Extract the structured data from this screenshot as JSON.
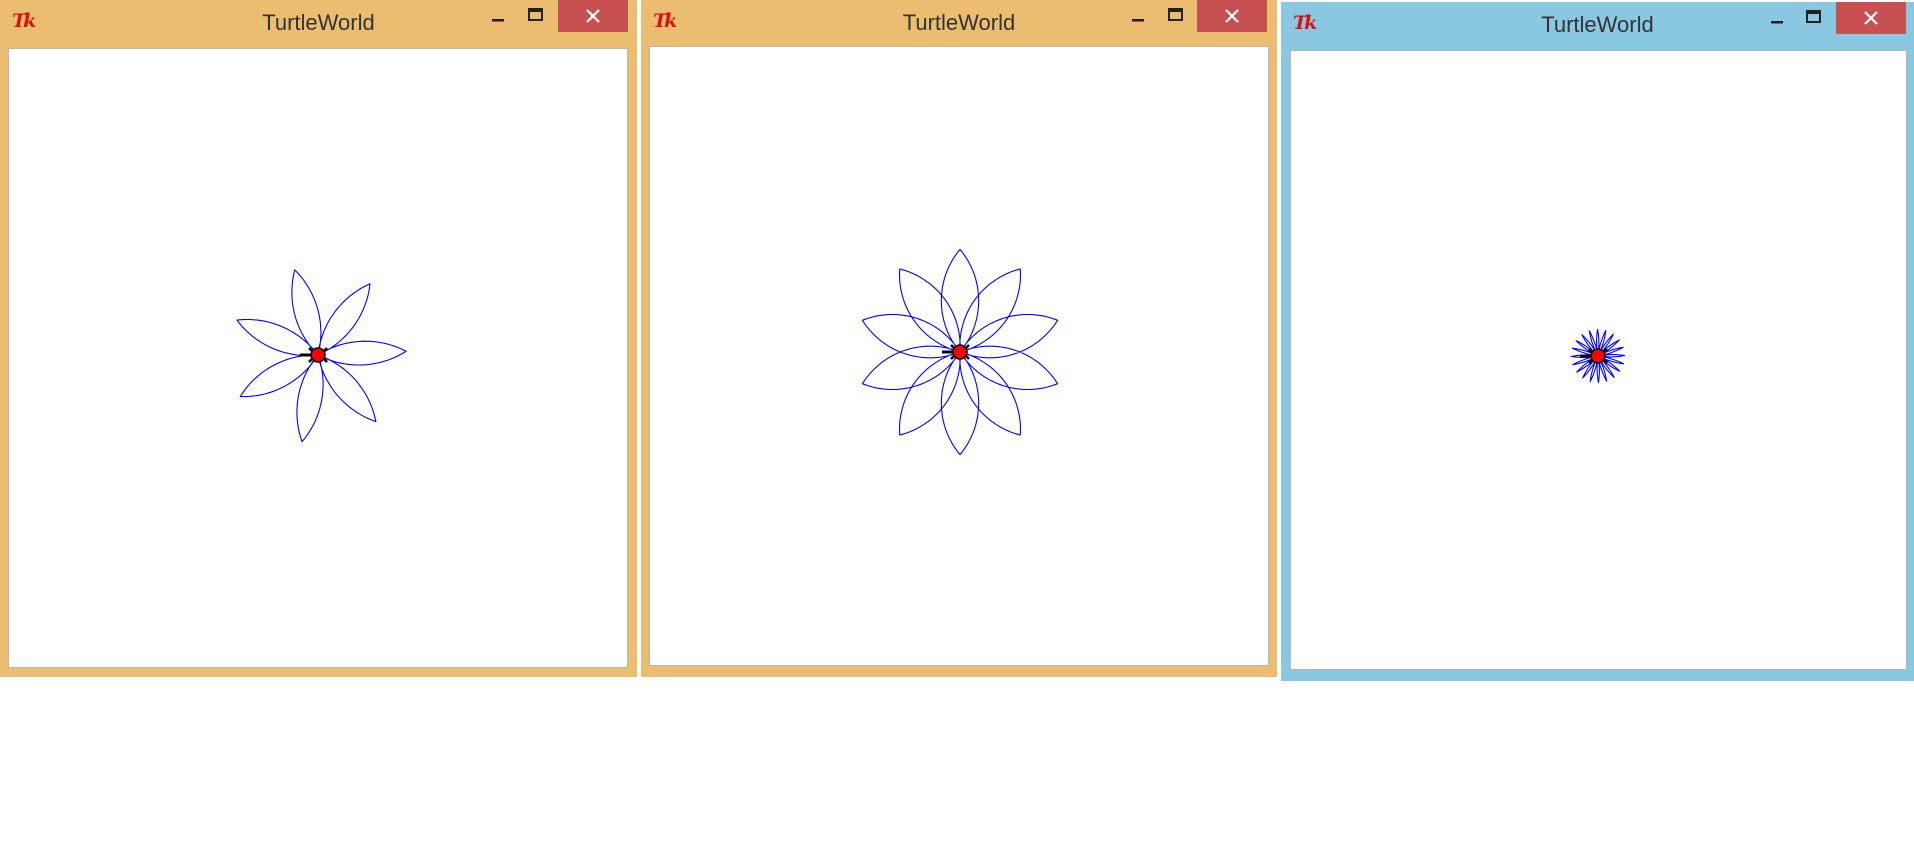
{
  "windows": [
    {
      "app_icon": "tk-logo-icon",
      "app_icon_text": "Tk",
      "title": "TurtleWorld",
      "frame_color": "#ebbd70",
      "drawing": {
        "shape": "flower",
        "petals": 7,
        "petal_size": 60,
        "petal_angle": 60,
        "stroke": "#0000ff"
      }
    },
    {
      "app_icon": "tk-logo-icon",
      "app_icon_text": "Tk",
      "title": "TurtleWorld",
      "frame_color": "#ebbd70",
      "drawing": {
        "shape": "flower",
        "petals": 10,
        "petal_size": 60,
        "petal_angle": 80,
        "stroke": "#0000ff"
      }
    },
    {
      "app_icon": "tk-logo-icon",
      "app_icon_text": "Tk",
      "title": "TurtleWorld",
      "frame_color": "#8ac8e2",
      "drawing": {
        "shape": "flower",
        "petals": 20,
        "petal_size": 60,
        "petal_angle": 20,
        "stroke": "#0000ff"
      }
    }
  ],
  "turtle": {
    "body_color": "#ff0000",
    "outline_color": "#000000"
  },
  "controls": {
    "minimize_icon": "minimize-icon",
    "maximize_icon": "maximize-icon",
    "close_icon": "close-icon",
    "close_color": "#c75050"
  }
}
